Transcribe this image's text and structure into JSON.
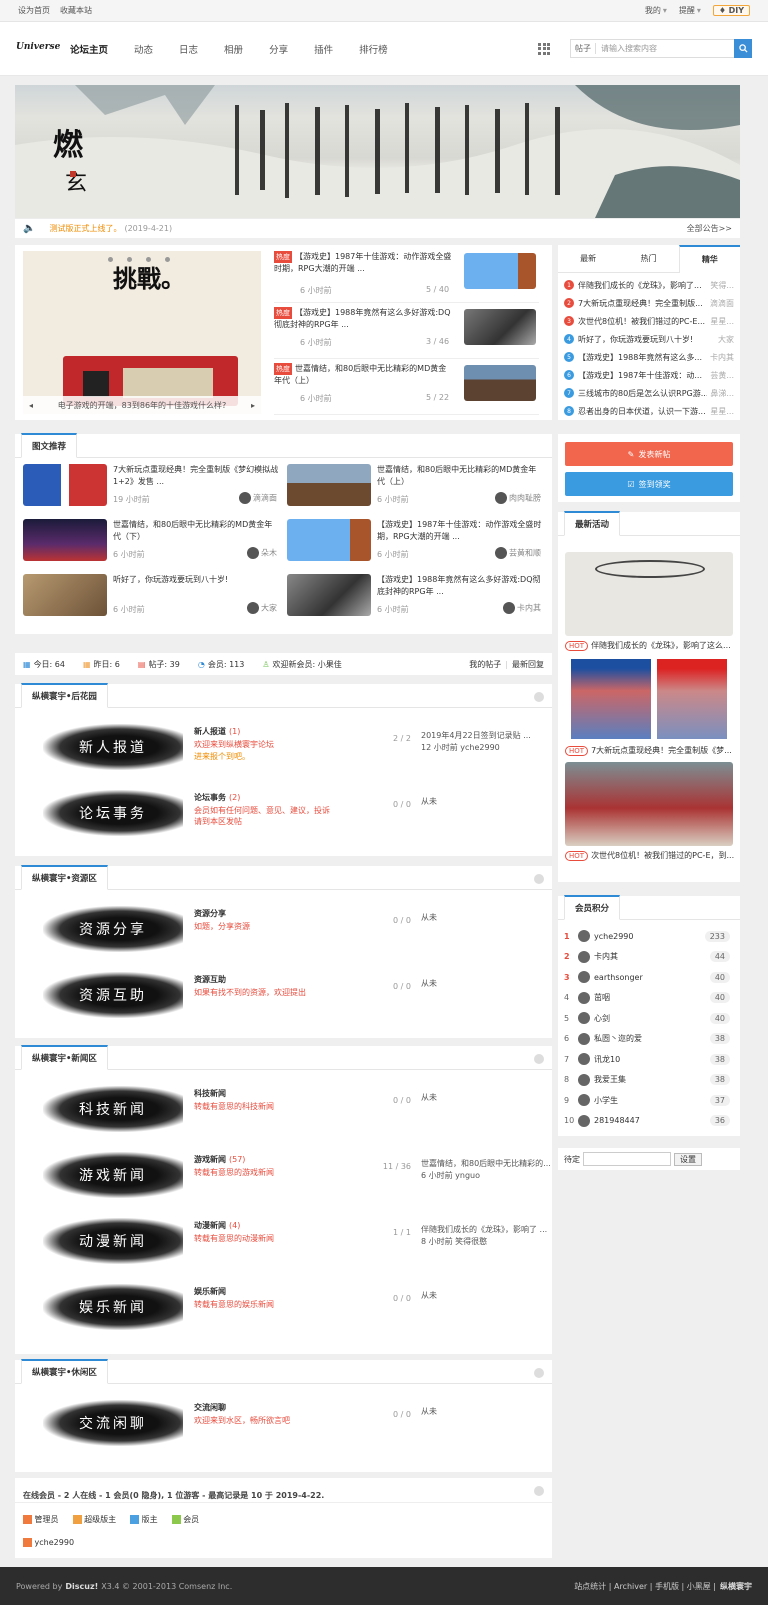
{
  "topbar": {
    "set_home": "设为首页",
    "bookmark": "收藏本站",
    "mine": "我的",
    "remind": "提醒",
    "diy": "DIY"
  },
  "header": {
    "logo": "Universe",
    "nav": [
      "论坛主页",
      "动态",
      "日志",
      "相册",
      "分享",
      "插件",
      "排行榜"
    ],
    "search_type": "帖子",
    "search_placeholder": "请输入搜索内容"
  },
  "notice": {
    "text": "测试版正式上线了。",
    "date": "(2019-4-21)",
    "all": "全部公告>>"
  },
  "slider": {
    "caption": "电子游戏的开端，83到86年的十佳游戏什么样?",
    "image_text": "挑戰。"
  },
  "hot_posts": [
    {
      "tag": "热度",
      "title": "【游戏史】1987年十佳游戏：动作游戏全盛时期，RPG大潮的开端 ...",
      "time": "6 小时前",
      "count": "5 / 40"
    },
    {
      "tag": "热度",
      "title": "【游戏史】1988年竟然有这么多好游戏:DQ彻底封神的RPG年 ...",
      "time": "6 小时前",
      "count": "3 / 46"
    },
    {
      "tag": "热度",
      "title": "世嘉情结，和80后眼中无比精彩的MD黄金年代（上）",
      "time": "6 小时前",
      "count": "5 / 22"
    }
  ],
  "side_tabs": [
    "最新",
    "热门",
    "精华"
  ],
  "side_list": [
    {
      "n": "1",
      "t": "伴随我们成长的《龙珠》，影响了...",
      "u": "笑得..."
    },
    {
      "n": "2",
      "t": "7大新玩点重现经典！完全重制版...",
      "u": "滴滴面"
    },
    {
      "n": "3",
      "t": "次世代8位机！被我们错过的PC-E...",
      "u": "星星..."
    },
    {
      "n": "4",
      "t": "听好了，你玩游戏要玩到八十岁!",
      "u": "大家"
    },
    {
      "n": "5",
      "t": "【游戏史】1988年竟然有这么多...",
      "u": "卡内其"
    },
    {
      "n": "6",
      "t": "【游戏史】1987年十佳游戏：动...",
      "u": "芸黄..."
    },
    {
      "n": "7",
      "t": "三线城市的80后是怎么认识RPG游...",
      "u": "鼻涕..."
    },
    {
      "n": "8",
      "t": "忍者出身的日本伏道，认识一下游...",
      "u": "星星..."
    }
  ],
  "post_btn": "发表新帖",
  "sign_btn": "签到领奖",
  "pic_title": "图文推荐",
  "pics": [
    {
      "t": "7大新玩点重现经典！完全重制版《梦幻模拟战1+2》发售 ...",
      "time": "19 小时前",
      "u": "滴滴面"
    },
    {
      "t": "世嘉情结，和80后眼中无比精彩的MD黄金年代（上）",
      "time": "6 小时前",
      "u": "肉肉耻膀"
    },
    {
      "t": "世嘉情结，和80后眼中无比精彩的MD黄金年代（下）",
      "time": "6 小时前",
      "u": "朵木"
    },
    {
      "t": "【游戏史】1987年十佳游戏：动作游戏全盛时期，RPG大潮的开端 ...",
      "time": "6 小时前",
      "u": "芸黄和顺"
    },
    {
      "t": "听好了，你玩游戏要玩到八十岁!",
      "time": "6 小时前",
      "u": "大家"
    },
    {
      "t": "【游戏史】1988年竟然有这么多好游戏:DQ彻底封神的RPG年 ...",
      "time": "6 小时前",
      "u": "卡内其"
    }
  ],
  "stats": {
    "today": "今日: 64",
    "yesterday": "昨日: 6",
    "posts": "帖子: 39",
    "members": "会员: 113",
    "welcome": "欢迎新会员: 小果佳",
    "my_posts": "我的帖子",
    "latest": "最新回复"
  },
  "activity_title": "最新活动",
  "activities": [
    {
      "tag": "HOT",
      "t": "伴随我们成长的《龙珠》，影响了这么..."
    },
    {
      "tag": "HOT",
      "t": "7大新玩点重现经典！完全重制版《梦..."
    },
    {
      "tag": "HOT",
      "t": "次世代8位机！被我们错过的PC-E，到..."
    }
  ],
  "groups": [
    {
      "title": "纵横寰宇•后花园",
      "forums": [
        {
          "logo": "新人报道",
          "name": "新人报道",
          "count": "(1)",
          "desc": "欢迎来到纵横寰宇论坛",
          "desc2": "进来报个到吧。",
          "nums": "2 / 2",
          "last1": "2019年4月22日签到记录贴 ...",
          "last2": "12 小时前 yche2990"
        },
        {
          "logo": "论坛事务",
          "name": "论坛事务",
          "count": "(2)",
          "desc": "会员如有任何问题、意见、建议，投诉请到本区发帖",
          "desc2": "",
          "nums": "0 / 0",
          "last1": "从未",
          "last2": ""
        }
      ]
    },
    {
      "title": "纵横寰宇•资源区",
      "forums": [
        {
          "logo": "资源分享",
          "name": "资源分享",
          "count": "",
          "desc": "如题，分享资源",
          "desc2": "",
          "nums": "0 / 0",
          "last1": "从未",
          "last2": ""
        },
        {
          "logo": "资源互助",
          "name": "资源互助",
          "count": "",
          "desc": "如果有找不到的资源，欢迎提出",
          "desc2": "",
          "nums": "0 / 0",
          "last1": "从未",
          "last2": ""
        }
      ]
    },
    {
      "title": "纵横寰宇•新闻区",
      "forums": [
        {
          "logo": "科技新闻",
          "name": "科技新闻",
          "count": "",
          "desc": "转载有意思的科技新闻",
          "desc2": "",
          "nums": "0 / 0",
          "last1": "从未",
          "last2": ""
        },
        {
          "logo": "游戏新闻",
          "name": "游戏新闻",
          "count": "(57)",
          "desc": "转载有意思的游戏新闻",
          "desc2": "",
          "nums": "11 / 36",
          "last1": "世嘉情结，和80后眼中无比精彩的...",
          "last2": "6 小时前 ynguo"
        },
        {
          "logo": "动漫新闻",
          "name": "动漫新闻",
          "count": "(4)",
          "desc": "转载有意思的动漫新闻",
          "desc2": "",
          "nums": "1 / 1",
          "last1": "伴随我们成长的《龙珠》，影响了 ...",
          "last2": "8 小时前 笑得很憨"
        },
        {
          "logo": "娱乐新闻",
          "name": "娱乐新闻",
          "count": "",
          "desc": "转载有意思的娱乐新闻",
          "desc2": "",
          "nums": "0 / 0",
          "last1": "从未",
          "last2": ""
        }
      ]
    },
    {
      "title": "纵横寰宇•休闲区",
      "forums": [
        {
          "logo": "交流闲聊",
          "name": "交流闲聊",
          "count": "",
          "desc": "欢迎来到水区，畅所欲言吧",
          "desc2": "",
          "nums": "0 / 0",
          "last1": "从未",
          "last2": ""
        }
      ]
    }
  ],
  "points_title": "会员积分",
  "points": [
    {
      "n": "1",
      "u": "yche2990",
      "s": "233"
    },
    {
      "n": "2",
      "u": "卡内其",
      "s": "44"
    },
    {
      "n": "3",
      "u": "earthsonger",
      "s": "40"
    },
    {
      "n": "4",
      "u": "茁咽",
      "s": "40"
    },
    {
      "n": "5",
      "u": "心剑",
      "s": "40"
    },
    {
      "n": "6",
      "u": "私圄丶迩的爱",
      "s": "38"
    },
    {
      "n": "7",
      "u": "讯龙10",
      "s": "38"
    },
    {
      "n": "8",
      "u": "我爱王集",
      "s": "38"
    },
    {
      "n": "9",
      "u": "小学生",
      "s": "37"
    },
    {
      "n": "10",
      "u": "281948447",
      "s": "36"
    }
  ],
  "pending": {
    "label": "待定",
    "btn": "设置"
  },
  "online": {
    "title": "在线会员 - 2 人在线 - 1 会员(0 隐身), 1 位游客 - 最高记录是 10 于 2019-4-22.",
    "legend": [
      "管理员",
      "超级版主",
      "版主",
      "会员"
    ],
    "user": "yche2990"
  },
  "footer": {
    "powered": "Powered by",
    "brand": "Discuz!",
    "ver": "X3.4 © 2001-2013 Comsenz Inc.",
    "links": "站点统计 | Archiver | 手机版 | 小黑屋 |",
    "site": "纵横寰宇"
  },
  "colors": {
    "accent": "#2f8ad6",
    "red": "#e84c3d",
    "post_btn": "#f2664e",
    "sign_btn": "#3a9be0"
  }
}
